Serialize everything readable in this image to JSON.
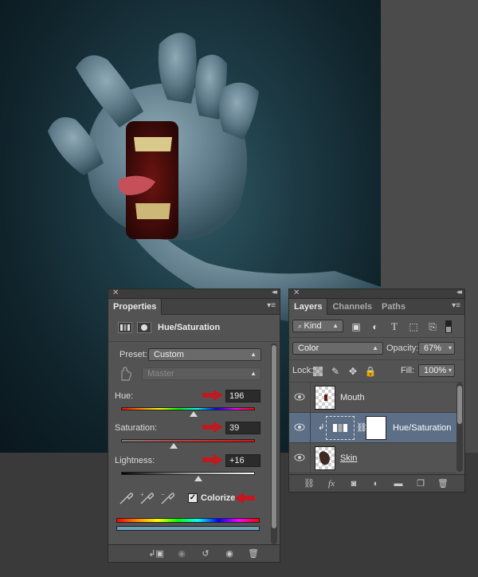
{
  "properties": {
    "tab": "Properties",
    "title": "Hue/Saturation",
    "preset_label": "Preset:",
    "preset_value": "Custom",
    "channel_value": "Master",
    "hue_label": "Hue:",
    "hue_value": "196",
    "saturation_label": "Saturation:",
    "saturation_value": "39",
    "lightness_label": "Lightness:",
    "lightness_value": "+16",
    "colorize_label": "Colorize",
    "colorize_checked": "✓"
  },
  "layers": {
    "tabs": [
      "Layers",
      "Channels",
      "Paths"
    ],
    "filter_kind": "Kind",
    "blend_mode": "Color",
    "opacity_label": "Opacity:",
    "opacity_value": "67%",
    "lock_label": "Lock:",
    "fill_label": "Fill:",
    "fill_value": "100%",
    "items": [
      {
        "name": "Mouth"
      },
      {
        "name": "Hue/Saturation"
      },
      {
        "name": "Skin"
      }
    ]
  },
  "colors": {
    "panel_bg": "#535353",
    "selected_layer": "#5c6f86",
    "arrow_red": "#c0191f",
    "canvas_bg": "#1d3a44"
  }
}
